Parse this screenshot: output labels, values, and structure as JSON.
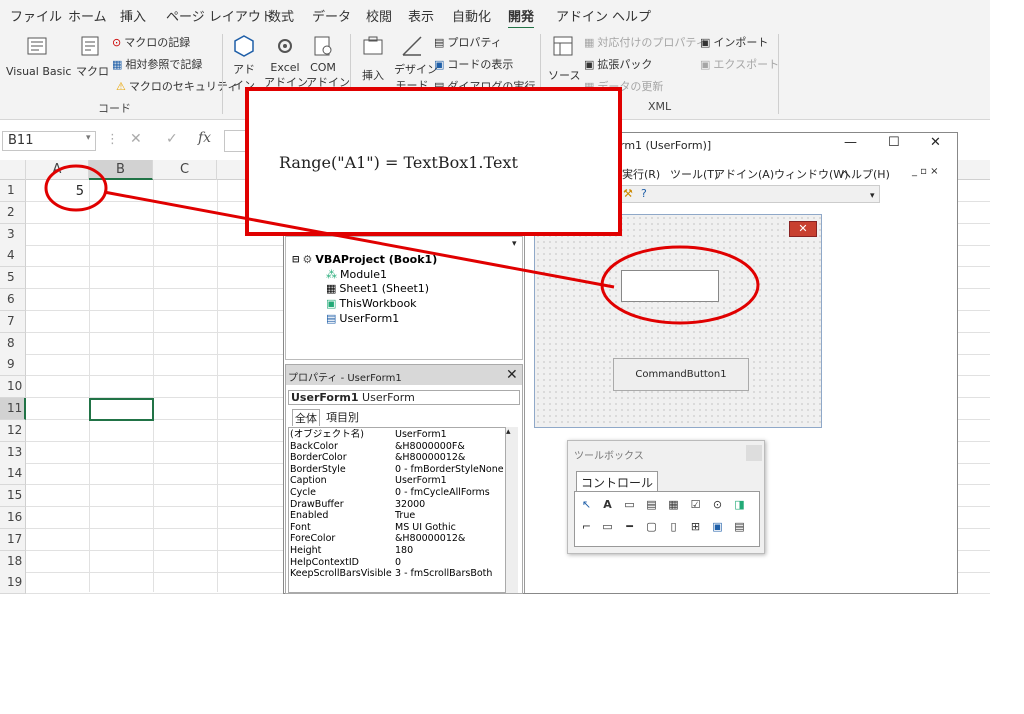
{
  "ribbon_tabs": [
    "ファイル",
    "ホーム",
    "挿入",
    "ページ レイアウト",
    "数式",
    "データ",
    "校閲",
    "表示",
    "自動化",
    "開発",
    "アドイン",
    "ヘルプ"
  ],
  "active_tab": "開発",
  "ribbon": {
    "visual_basic": "Visual Basic",
    "macro": "マクロ",
    "record_macro": "マクロの記録",
    "relative_ref": "相対参照で記録",
    "macro_security": "マクロのセキュリティ",
    "group_code": "コード",
    "addins_line1": "アド",
    "addins_line2": "イン",
    "excel_addins_line1": "Excel",
    "excel_addins_line2": "アドイン",
    "com_addins_line1": "COM",
    "com_addins_line2": "アドイン",
    "insert": "挿入",
    "design_mode_line1": "デザイン",
    "design_mode_line2": "モード",
    "properties": "プロパティ",
    "view_code": "コードの表示",
    "run_dialog": "ダイアログの実行",
    "source": "ソース",
    "map_props": "対応付けのプロパティ",
    "expansion_packs": "拡張パック",
    "refresh_data": "データの更新",
    "import": "インポート",
    "export": "エクスポート",
    "group_xml": "XML"
  },
  "formula_bar": {
    "name_box": "B11",
    "fx": "fx"
  },
  "columns": [
    "A",
    "B",
    "C"
  ],
  "rows": [
    "1",
    "2",
    "3",
    "4",
    "5",
    "6",
    "7",
    "8",
    "9",
    "10",
    "11",
    "12",
    "13",
    "14",
    "15",
    "16",
    "17",
    "18",
    "19"
  ],
  "cell_a1": "5",
  "callout_text": "Range(\"A1\") = TextBox1.Text",
  "vbe": {
    "title": "rm1 (UserForm)]",
    "menu": [
      "実行(R)",
      "ツール(T)",
      "アドイン(A)",
      "ウィンドウ(W)",
      "ヘルプ(H)"
    ],
    "min": "—",
    "max": "☐",
    "close": "✕",
    "project_root": "VBAProject (Book1)",
    "project_items": [
      "Module1",
      "Sheet1 (Sheet1)",
      "ThisWorkbook",
      "UserForm1"
    ],
    "props_title": "プロパティ - UserForm1",
    "props_object": "UserForm1",
    "props_object_type": "UserForm",
    "props_tab_all": "全体",
    "props_tab_cat": "項目別",
    "props": [
      [
        "(オブジェクト名)",
        "UserForm1"
      ],
      [
        "BackColor",
        "&H8000000F&"
      ],
      [
        "BorderColor",
        "&H80000012&"
      ],
      [
        "BorderStyle",
        "0 - fmBorderStyleNone"
      ],
      [
        "Caption",
        "UserForm1"
      ],
      [
        "Cycle",
        "0 - fmCycleAllForms"
      ],
      [
        "DrawBuffer",
        "32000"
      ],
      [
        "Enabled",
        "True"
      ],
      [
        "Font",
        "MS UI Gothic"
      ],
      [
        "ForeColor",
        "&H80000012&"
      ],
      [
        "Height",
        "180"
      ],
      [
        "HelpContextID",
        "0"
      ],
      [
        "KeepScrollBarsVisible",
        "3 - fmScrollBarsBoth"
      ]
    ],
    "command_button": "CommandButton1",
    "toolbox_title": "ツールボックス",
    "toolbox_tab": "コントロール"
  },
  "colors": {
    "accent": "#217346",
    "annotation": "#e00000",
    "selection": "#217346"
  }
}
